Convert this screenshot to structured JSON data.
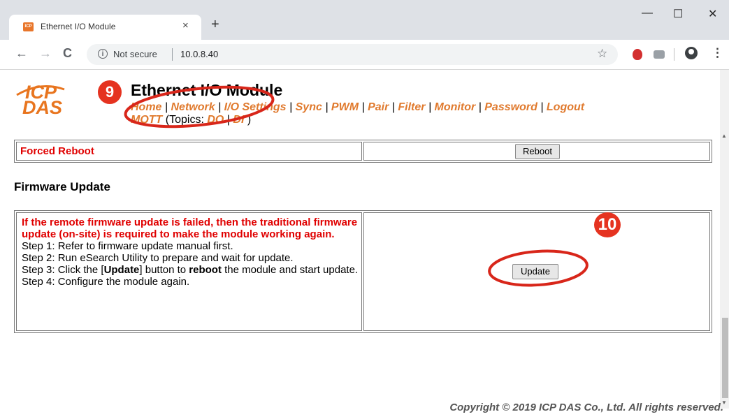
{
  "browser": {
    "tab_title": "Ethernet I/O Module",
    "tab_close": "×",
    "new_tab": "+",
    "minimize": "—",
    "maximize": "☐",
    "close": "✕",
    "back": "←",
    "forward": "→",
    "reload": "C",
    "security_label": "Not secure",
    "url": "10.0.8.40",
    "bookmark_star": "☆",
    "menu": "⋮"
  },
  "header": {
    "logo_top": "ICP",
    "logo_bottom": "DAS",
    "title": "Ethernet I/O Module",
    "nav": [
      "Home",
      "Network",
      "I/O Settings",
      "Sync",
      "PWM",
      "Pair",
      "Filter",
      "Monitor",
      "Password",
      "Logout"
    ],
    "mqtt": "MQTT",
    "topics_label": "(Topics:",
    "topics": [
      "DO",
      "DI"
    ],
    "topics_close": ")"
  },
  "annotations": {
    "badge_9": "9",
    "badge_10": "10"
  },
  "reboot_row": {
    "label": "Forced Reboot",
    "button": "Reboot"
  },
  "firmware": {
    "title": "Firmware Update",
    "warning": "If the remote firmware update is failed, then the traditional firmware update (on-site) is required to make the module working again.",
    "step1": "Step 1: Refer to firmware update manual first.",
    "step2": "Step 2: Run eSearch Utility to prepare and wait for update.",
    "step3_a": "Step 3: Click the [",
    "step3_b": "Update",
    "step3_c": "] button to ",
    "step3_d": "reboot",
    "step3_e": " the module and start update.",
    "step4": "Step 4: Configure the module again.",
    "button": "Update"
  },
  "footer": {
    "copyright": "Copyright © 2019 ICP DAS Co., Ltd. All rights reserved."
  },
  "colors": {
    "accent_orange": "#e07a2e",
    "warning_red": "#e00000",
    "annotation_red": "#e53320"
  }
}
